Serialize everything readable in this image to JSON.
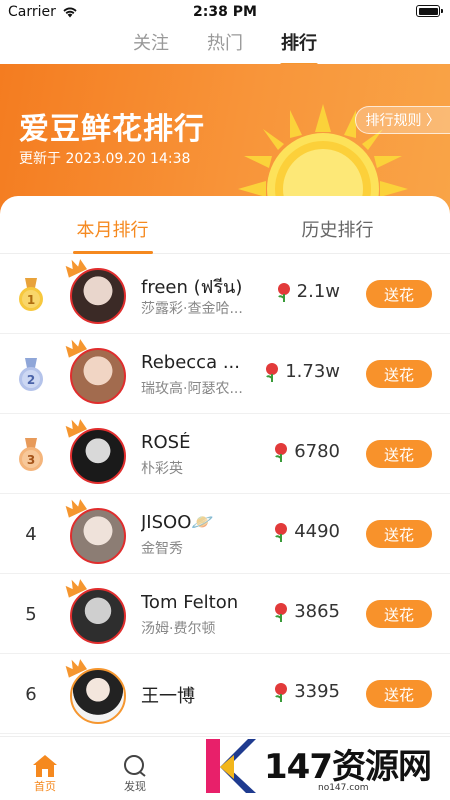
{
  "status_bar": {
    "carrier": "Carrier",
    "time": "2:38 PM"
  },
  "top_tabs": [
    {
      "label": "关注",
      "active": false
    },
    {
      "label": "热门",
      "active": false
    },
    {
      "label": "排行",
      "active": true
    }
  ],
  "banner": {
    "title": "爱豆鲜花排行",
    "update_text": "更新于 2023.09.20 14:38",
    "rules_label": "排行规则 〉"
  },
  "sub_tabs": [
    {
      "label": "本月排行",
      "active": true
    },
    {
      "label": "历史排行",
      "active": false
    }
  ],
  "ranking": [
    {
      "rank": "1",
      "name": "freen (ฟรีน)",
      "subname": "莎露彩·查金哈...",
      "count": "2.1w",
      "button": "送花",
      "medal": "gold"
    },
    {
      "rank": "2",
      "name": "Rebecca ...",
      "subname": "瑞玫高·阿瑟农...",
      "count": "1.73w",
      "button": "送花",
      "medal": "silver"
    },
    {
      "rank": "3",
      "name": "ROSÉ",
      "subname": "朴彩英",
      "count": "6780",
      "button": "送花",
      "medal": "bronze"
    },
    {
      "rank": "4",
      "name": "JISOO🪐",
      "subname": "金智秀",
      "count": "4490",
      "button": "送花",
      "medal": "none"
    },
    {
      "rank": "5",
      "name": "Tom Felton",
      "subname": "汤姆·费尔顿",
      "count": "3865",
      "button": "送花",
      "medal": "none"
    },
    {
      "rank": "6",
      "name": "王一博",
      "subname": "",
      "count": "3395",
      "button": "送花",
      "medal": "none"
    }
  ],
  "bottom_nav": [
    {
      "label": "首页",
      "icon": "home-icon",
      "active": true
    },
    {
      "label": "发现",
      "icon": "discover-icon",
      "active": false
    }
  ],
  "watermark": {
    "text": "147资源网",
    "sub": "no147.com"
  },
  "colors": {
    "accent": "#f5891f",
    "button": "#f8922b",
    "banner_start": "#f47c20",
    "banner_end": "#f9a447",
    "avatar_border": "#e02d2d"
  }
}
